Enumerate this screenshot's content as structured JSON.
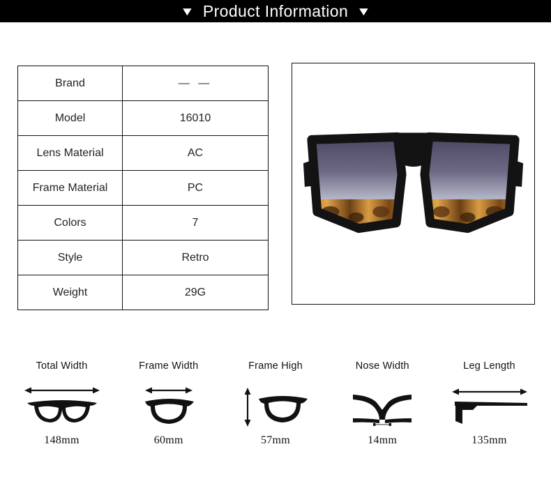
{
  "header": {
    "title": "Product Information",
    "left_marker": "▼",
    "right_marker": "▼"
  },
  "spec_table": {
    "rows": [
      {
        "label": "Brand",
        "value": "— —"
      },
      {
        "label": "Model",
        "value": "16010"
      },
      {
        "label": "Lens Material",
        "value": "AC"
      },
      {
        "label": "Frame Material",
        "value": "PC"
      },
      {
        "label": "Colors",
        "value": "7"
      },
      {
        "label": "Style",
        "value": "Retro"
      },
      {
        "label": "Weight",
        "value": "29G"
      }
    ]
  },
  "product_image": {
    "alt": "oversized square sunglasses, black frame with tortoiseshell lower rim and gradient grey-purple lenses",
    "colors": {
      "frame": "#111111",
      "tortoise_base": "#c98a32",
      "tortoise_spot": "#4d2d10",
      "lens_top": "#4a4560",
      "lens_bottom": "#f2f3f7",
      "background": "#ffffff"
    }
  },
  "measurements": [
    {
      "label": "Total Width",
      "value": "148mm",
      "icon": "glasses-front-icon",
      "arrow": "horizontal"
    },
    {
      "label": "Frame Width",
      "value": "60mm",
      "icon": "single-lens-width-icon",
      "arrow": "horizontal"
    },
    {
      "label": "Frame High",
      "value": "57mm",
      "icon": "single-lens-height-icon",
      "arrow": "vertical"
    },
    {
      "label": "Nose Width",
      "value": "14mm",
      "icon": "nose-bridge-icon",
      "arrow": "horizontal"
    },
    {
      "label": "Leg Length",
      "value": "135mm",
      "icon": "temple-arm-icon",
      "arrow": "horizontal"
    }
  ]
}
